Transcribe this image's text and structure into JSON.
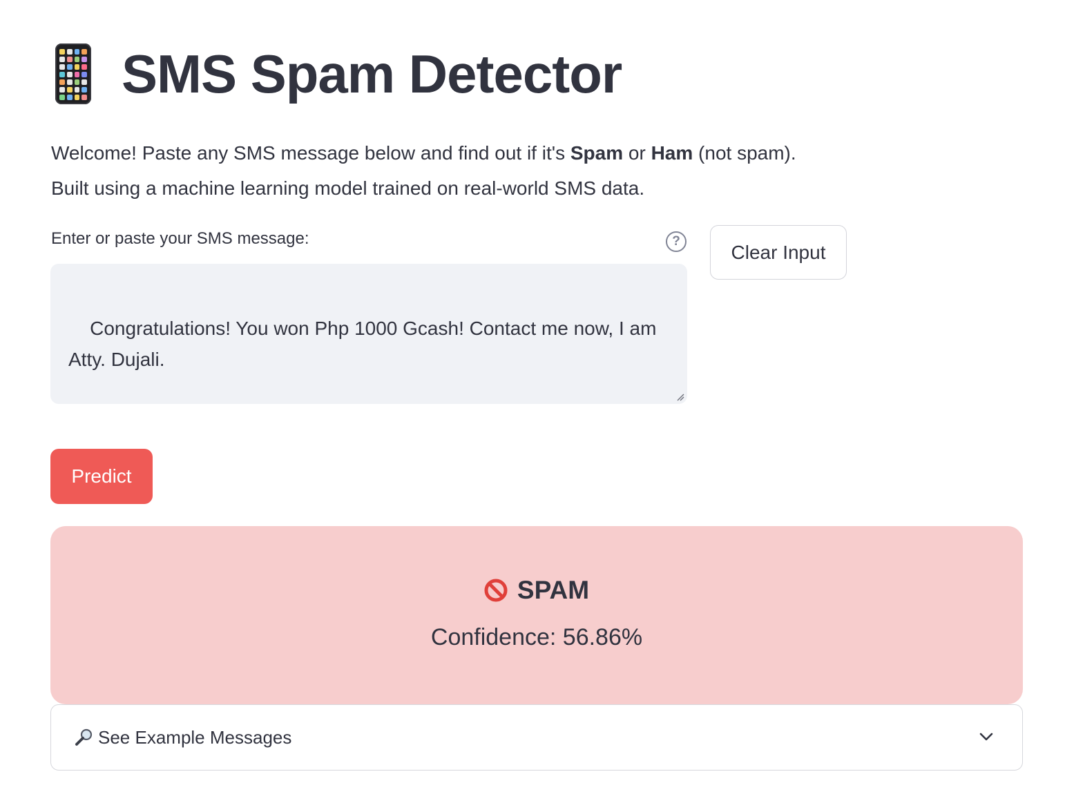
{
  "header": {
    "title": "SMS Spam Detector",
    "icon": "mobile-phone-icon"
  },
  "intro": {
    "line1_prefix": "Welcome! Paste any SMS message below and find out if it's ",
    "spam_word": "Spam",
    "or_word": " or ",
    "ham_word": "Ham",
    "line1_suffix": " (not spam).",
    "line2": "Built using a machine learning model trained on real-world SMS data."
  },
  "input": {
    "label": "Enter or paste your SMS message:",
    "help_glyph": "?",
    "value": "Congratulations! You won Php 1000 Gcash! Contact me now, I am\nAtty. Dujali."
  },
  "buttons": {
    "clear_label": "Clear Input",
    "predict_label": "Predict"
  },
  "result": {
    "label": "SPAM",
    "confidence": "Confidence: 56.86%",
    "icon": "no-entry-icon"
  },
  "expander": {
    "label": "See Example Messages",
    "icon": "magnifier-icon"
  },
  "colors": {
    "accent": "#ef5a56",
    "result_bg": "#f7cdcd",
    "input_bg": "#f0f2f6",
    "text": "#31333f"
  }
}
